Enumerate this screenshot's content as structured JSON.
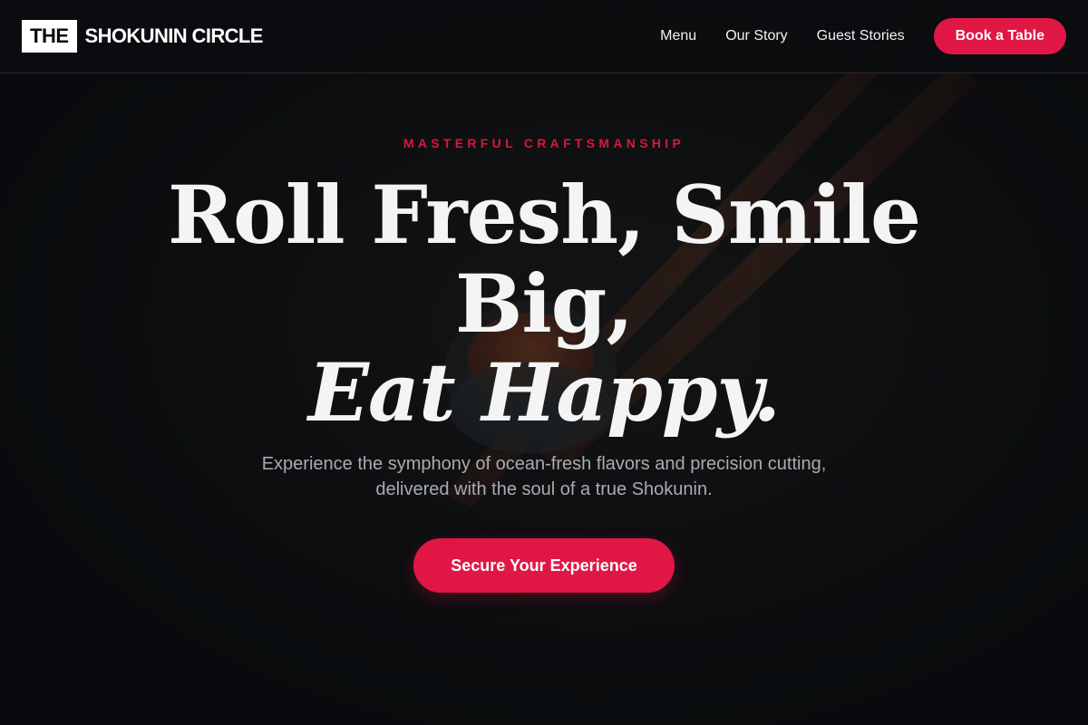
{
  "header": {
    "logo_box": "THE",
    "logo_text": "SHOKUNIN CIRCLE",
    "nav": [
      "Menu",
      "Our Story",
      "Guest Stories"
    ],
    "cta": "Book a Table"
  },
  "hero": {
    "eyebrow": "MASTERFUL CRAFTSMANSHIP",
    "headline_line1": "Roll Fresh, Smile",
    "headline_line2": "Big,",
    "headline_line3": "Eat Happy.",
    "subtitle": "Experience the symphony of ocean-fresh flavors and precision cutting, delivered with the soul of a true Shokunin.",
    "cta": "Secure Your Experience",
    "background_image": "chopsticks-holding-sushi-roll-photo"
  },
  "colors": {
    "accent": "#e01745",
    "background": "#0b0d0f",
    "text": "#f4f4f4",
    "muted": "#a9acb0"
  }
}
